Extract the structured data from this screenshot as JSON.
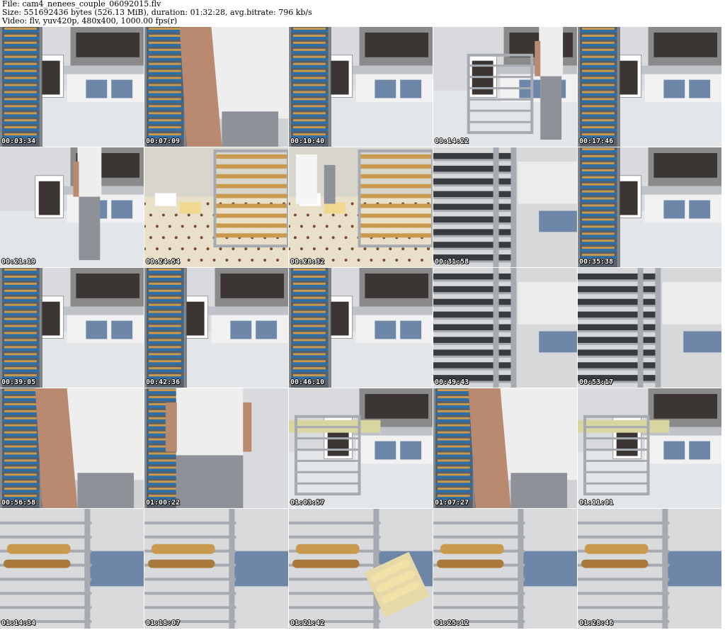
{
  "header": {
    "file_line": "File: cam4_nenees_couple_06092015.flv",
    "size_line": "Size: 551692436 bytes (526.13 MiB), duration: 01:32:28, avg.bitrate: 796 kb/s",
    "video_line": "Video: flv, yuv420p, 480x400, 1000.00 fps(r)"
  },
  "thumbnails": [
    {
      "time": "00:03:34",
      "scene": "rack-left-oven"
    },
    {
      "time": "00:07:09",
      "scene": "arm-closeup"
    },
    {
      "time": "00:10:40",
      "scene": "rack-left-oven"
    },
    {
      "time": "00:14:22",
      "scene": "worker-cart"
    },
    {
      "time": "00:17:46",
      "scene": "rack-left-oven"
    },
    {
      "time": "00:21:19",
      "scene": "worker-standing"
    },
    {
      "time": "00:24:54",
      "scene": "tiled-floor-rack"
    },
    {
      "time": "00:28:32",
      "scene": "tiled-floor-worker"
    },
    {
      "time": "00:31:58",
      "scene": "rack-closeup"
    },
    {
      "time": "00:35:38",
      "scene": "rack-left-oven"
    },
    {
      "time": "00:39:05",
      "scene": "rack-left-oven"
    },
    {
      "time": "00:42:36",
      "scene": "rack-left-oven"
    },
    {
      "time": "00:46:10",
      "scene": "rack-left-oven"
    },
    {
      "time": "00:49:43",
      "scene": "rack-closeup"
    },
    {
      "time": "00:53:17",
      "scene": "rack-closeup"
    },
    {
      "time": "00:56:58",
      "scene": "arm-closeup"
    },
    {
      "time": "01:00:22",
      "scene": "worker-torso"
    },
    {
      "time": "01:03:57",
      "scene": "cart-dough"
    },
    {
      "time": "01:07:27",
      "scene": "arm-closeup"
    },
    {
      "time": "01:11:01",
      "scene": "cart-dough"
    },
    {
      "time": "01:14:34",
      "scene": "baguette-rack"
    },
    {
      "time": "01:18:07",
      "scene": "baguette-rack"
    },
    {
      "time": "01:21:42",
      "scene": "baguette-board"
    },
    {
      "time": "01:25:12",
      "scene": "baguette-rack"
    },
    {
      "time": "01:28:46",
      "scene": "baguette-rack"
    }
  ],
  "colors": {
    "floor": "#e3e6e8",
    "wall": "#d9dadd",
    "steel": "#a7abb1",
    "oven_dark": "#3b3533",
    "rack_blue": "#2f6fa5",
    "bread": "#c99a4d",
    "cabinet_blue": "#6e86a8",
    "shirt": "#eeeeee",
    "skin": "#b98a70",
    "pants": "#8e9298",
    "tile_dot": "#7a4a30"
  }
}
